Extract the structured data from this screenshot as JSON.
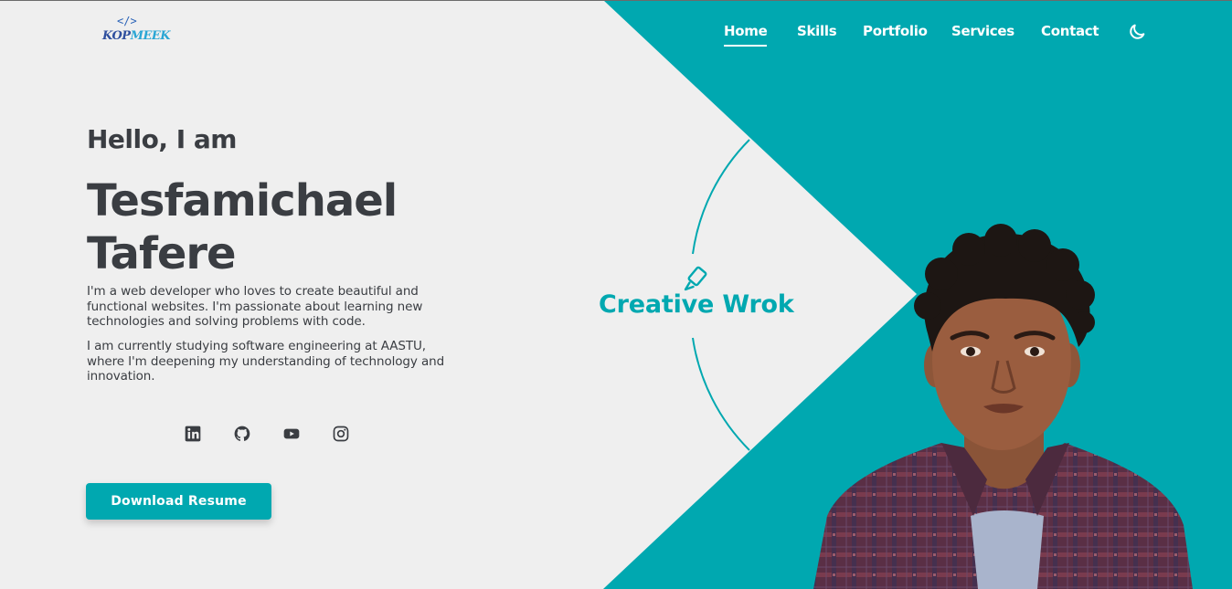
{
  "colors": {
    "accent": "#00a8b0",
    "background": "#efefef",
    "text": "#3a3d42"
  },
  "logo": {
    "symbol": "</>",
    "text_a": "KOP",
    "text_b": "MEEK"
  },
  "nav": {
    "items": [
      {
        "label": "Home",
        "active": true
      },
      {
        "label": "Skills"
      },
      {
        "label": "Portfolio"
      },
      {
        "label": "Services"
      },
      {
        "label": "Contact"
      }
    ],
    "theme_toggle_icon": "moon-icon"
  },
  "hero": {
    "greeting": "Hello, I am",
    "name_line1": "Tesfamichael",
    "name_line2": "Tafere",
    "paragraph1": "I'm a web developer who loves to create beautiful and functional websites. I'm passionate about learning new technologies and solving problems with code.",
    "paragraph2": "I am currently studying software engineering at AASTU, where I'm deepening my understanding of technology and innovation.",
    "socials": [
      "linkedin-icon",
      "github-icon",
      "youtube-icon",
      "instagram-icon"
    ],
    "resume_button": "Download Resume"
  },
  "creative": {
    "label": "Creative Wrok",
    "icon": "paintbrush-icon"
  },
  "portrait": {
    "alt": "portrait-photo"
  }
}
